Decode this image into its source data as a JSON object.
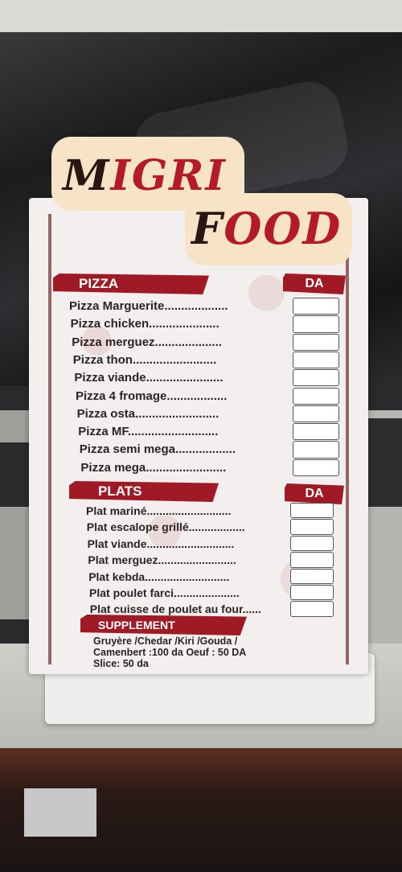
{
  "brand": {
    "line1_a": "M",
    "line1_b": "IGRI",
    "line2_a": "F",
    "line2_b": "OOD"
  },
  "pizza": {
    "heading": "PIZZA",
    "currency": "DA",
    "items": [
      "Pizza Marguerite...................",
      "Pizza chicken.....................",
      "Pizza merguez....................",
      "Pizza thon.........................",
      "Pizza viande.......................",
      "Pizza 4 fromage..................",
      "Pizza osta.........................",
      "Pizza MF...........................",
      "Pizza semi mega..................",
      "Pizza mega........................"
    ]
  },
  "plats": {
    "heading": "PLATS",
    "currency": "DA",
    "items": [
      "Plat mariné...........................",
      "Plat escalope grillé..................",
      "Plat viande............................",
      "Plat merguez.........................",
      "Plat kebda...........................",
      "Plat poulet farci.....................",
      "Plat cuisse de poulet au four......"
    ]
  },
  "supplement": {
    "heading": "SUPPLEMENT",
    "line1": "Gruyère /Chedar /Kiri /Gouda /",
    "line2": "Camenbert :100 da Oeuf : 50 DA",
    "line3": "Slice: 50 da"
  },
  "colors": {
    "accent": "#a01a26",
    "logo_plate": "#f7e3c6",
    "ink": "#2a1714"
  }
}
